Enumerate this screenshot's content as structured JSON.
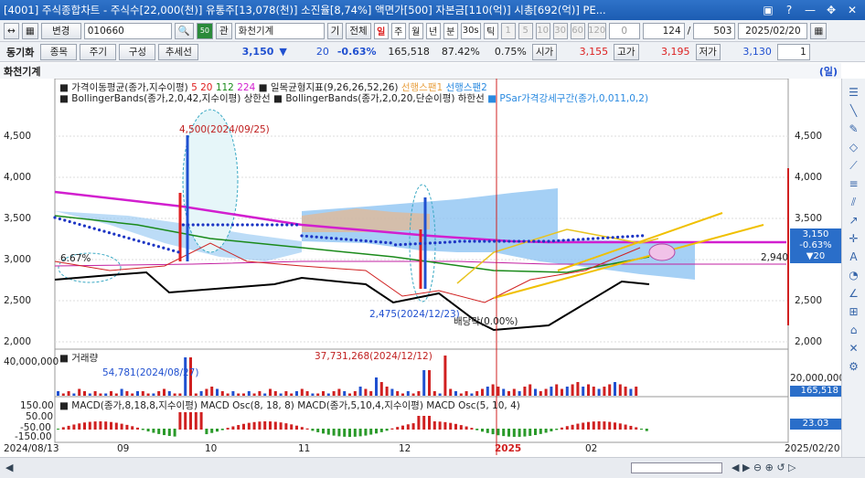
{
  "window": {
    "title": "[4001] 주식종합차트 - 주식수[22,000(천)] 유통주[13,078(천)] 소진율[8,74%] 액면가[500] 자본금[110(억)] 시총[692(억)] PE..."
  },
  "toolbar": {
    "change": "변경",
    "code": "010660",
    "jong": "관",
    "name": "화천기계",
    "all": "전체",
    "periods": [
      "일",
      "주",
      "월",
      "년",
      "분",
      "30s",
      "틱"
    ],
    "ticks": [
      "1",
      "5",
      "10",
      "30",
      "60",
      "120"
    ],
    "zero": "0",
    "count": "124",
    "total": "503",
    "date": "2025/02/20",
    "one": "1"
  },
  "toolbar2": {
    "sync": "동기화",
    "btns": [
      "종목",
      "주기",
      "구성",
      "추세선"
    ],
    "price": "3,150",
    "arrow": "▼",
    "chg": "20",
    "pct": "-0.63%",
    "volume": "165,518",
    "ratio": "87.42%",
    "turn": "0.75%",
    "open_label": "시가",
    "open": "3,155",
    "high_label": "고가",
    "high": "3,195",
    "low_label": "저가",
    "low": "3,130"
  },
  "chart_title": {
    "name": "화천기계",
    "unit": "(일)"
  },
  "legend": {
    "l1a": "가격이동평균(종가,지수이평)",
    "ma": [
      "5",
      "20",
      "112",
      "224"
    ],
    "l1b": "일목균형지표(9,26,26,52,26)",
    "span1": "선행스팬1",
    "span2": "선행스팬2",
    "l2a": "BollingerBands(종가,2,0,42,지수이평) 상한선",
    "l2b": "BollingerBands(종가,2,0,20,단순이평) 하한선",
    "l2c": "PSar가격강세구간(종가,0,011,0,2)"
  },
  "annotations": {
    "hi": "4,500(2024/09/25)",
    "lo": "2,475(2024/12/23)",
    "div": "배당락(0.00%)",
    "pct": "6.67%",
    "vhi": "37,731,268(2024/12/12)",
    "vlo": "54,781(2024/08/27)"
  },
  "price_badge": {
    "a": "3,150",
    "b": "-0.63%",
    "c": "▼20",
    "ref": "2,940"
  },
  "yaxis": [
    "4,500",
    "4,000",
    "3,500",
    "3,000",
    "2,500",
    "2,000"
  ],
  "vol_label": "거래량",
  "vol_axis": [
    "40,000,000",
    "20,000,000"
  ],
  "vol_badge": "165,518",
  "macd_legend": "MACD(종가,8,18,8,지수이평) MACD Osc(8, 18, 8) MACD(종가,5,10,4,지수이평) MACD Osc(5, 10, 4)",
  "macd_axis": [
    "150.00",
    "50.00",
    "-50.00",
    "-150.00"
  ],
  "macd_badge": "23.03",
  "xaxis": {
    "start": "2024/08/13",
    "m9": "09",
    "m10": "10",
    "m11": "11",
    "m12": "12",
    "y": "2025",
    "m2": "02",
    "end": "2025/02/20"
  },
  "colors": {
    "up": "#e02020",
    "down": "#2050d0"
  }
}
